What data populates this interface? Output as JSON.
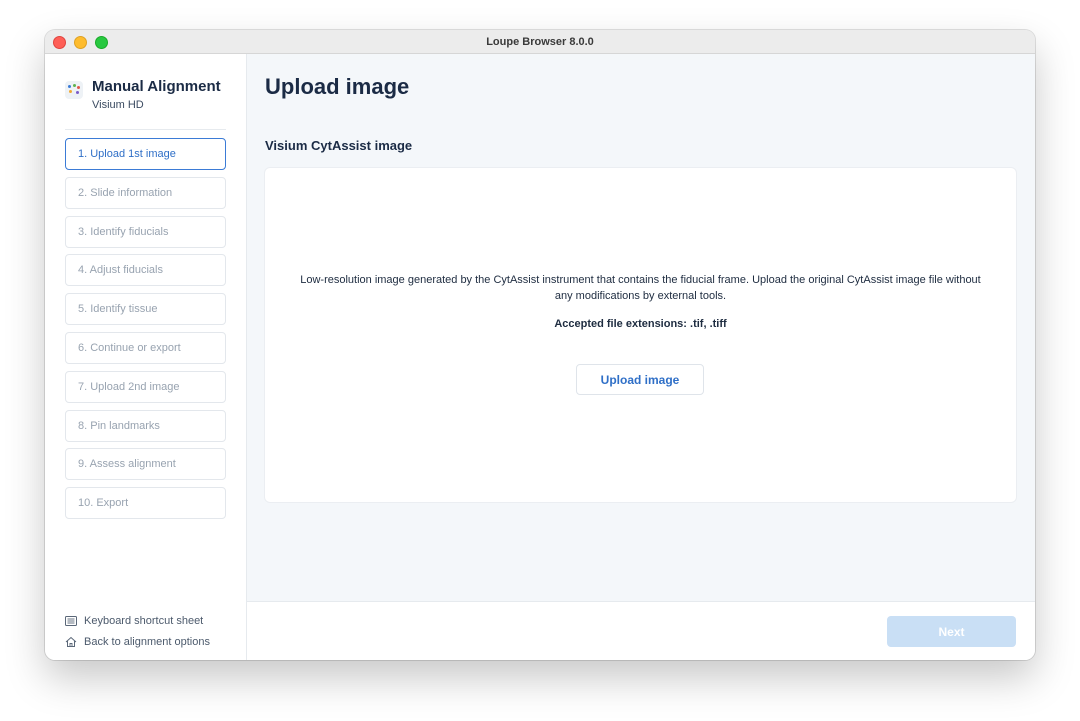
{
  "window": {
    "title": "Loupe Browser 8.0.0"
  },
  "sidebar": {
    "brand_title": "Manual Alignment",
    "brand_subtitle": "Visium HD",
    "steps": [
      {
        "label": "1. Upload 1st image",
        "state": "active"
      },
      {
        "label": "2. Slide information",
        "state": "disabled"
      },
      {
        "label": "3. Identify fiducials",
        "state": "disabled"
      },
      {
        "label": "4. Adjust fiducials",
        "state": "disabled"
      },
      {
        "label": "5. Identify tissue",
        "state": "disabled"
      },
      {
        "label": "6. Continue or export",
        "state": "disabled"
      },
      {
        "label": "7. Upload 2nd image",
        "state": "disabled"
      },
      {
        "label": "8. Pin landmarks",
        "state": "disabled"
      },
      {
        "label": "9. Assess alignment",
        "state": "disabled"
      },
      {
        "label": "10. Export",
        "state": "disabled"
      }
    ],
    "footer": {
      "keyboard_label": "Keyboard shortcut sheet",
      "back_label": "Back to alignment options"
    }
  },
  "main": {
    "page_title": "Upload image",
    "section_title": "Visium CytAssist image",
    "card": {
      "description": "Low-resolution image generated by the CytAssist instrument that contains the fiducial frame. Upload the original CytAssist image file without any modifications by external tools.",
      "extensions": "Accepted file extensions: .tif, .tiff",
      "upload_label": "Upload image"
    },
    "next_label": "Next"
  },
  "colors": {
    "accent": "#2f6fc7",
    "next_disabled": "#c9dff5",
    "heading": "#1b2b45"
  }
}
